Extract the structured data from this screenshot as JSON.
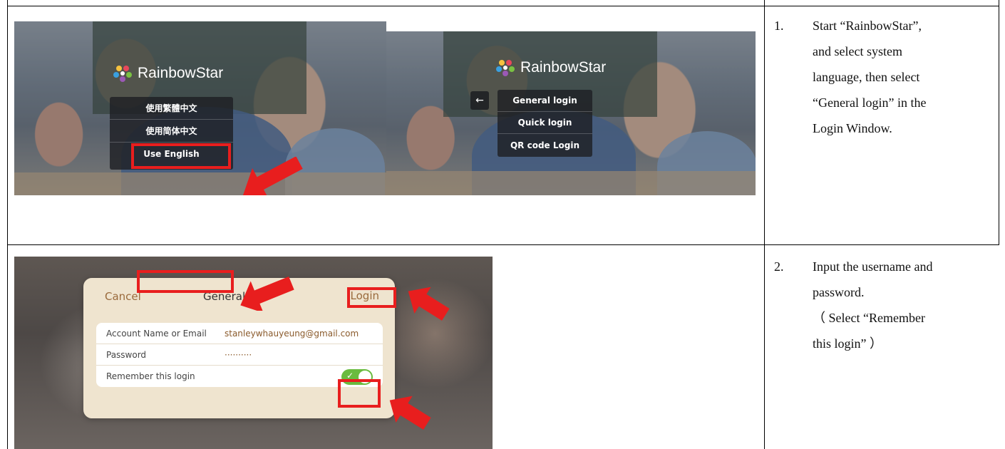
{
  "step1": {
    "brand_name": "RainbowStar",
    "language_menu": [
      "使用繁體中文",
      "使用简体中文",
      "Use English"
    ],
    "back_icon": "arrow-left-icon",
    "login_menu": [
      "General login",
      "Quick login",
      "QR code Login"
    ],
    "note_number": "1.",
    "note_lines": [
      "Start “RainbowStar”,",
      "and select system",
      "language, then select",
      "“General login” in the",
      "Login Window."
    ]
  },
  "step2": {
    "dialog": {
      "cancel": "Cancel",
      "title": "General lo",
      "login": "Login",
      "account_label": "Account Name or Email",
      "account_value": "stanleywhauyeung@gmail.com",
      "password_label": "Password",
      "password_value": "··········",
      "remember_label": "Remember this login",
      "remember_on": true
    },
    "note_number": "2.",
    "note_lines": [
      "Input the username and",
      "password.",
      "（ Select “Remember",
      "this login” ）"
    ]
  },
  "colors": {
    "highlight": "#e81e1e",
    "toggle_on": "#6abb3f",
    "dialog_bg": "#efe4cf",
    "link": "#9a6a3c"
  }
}
